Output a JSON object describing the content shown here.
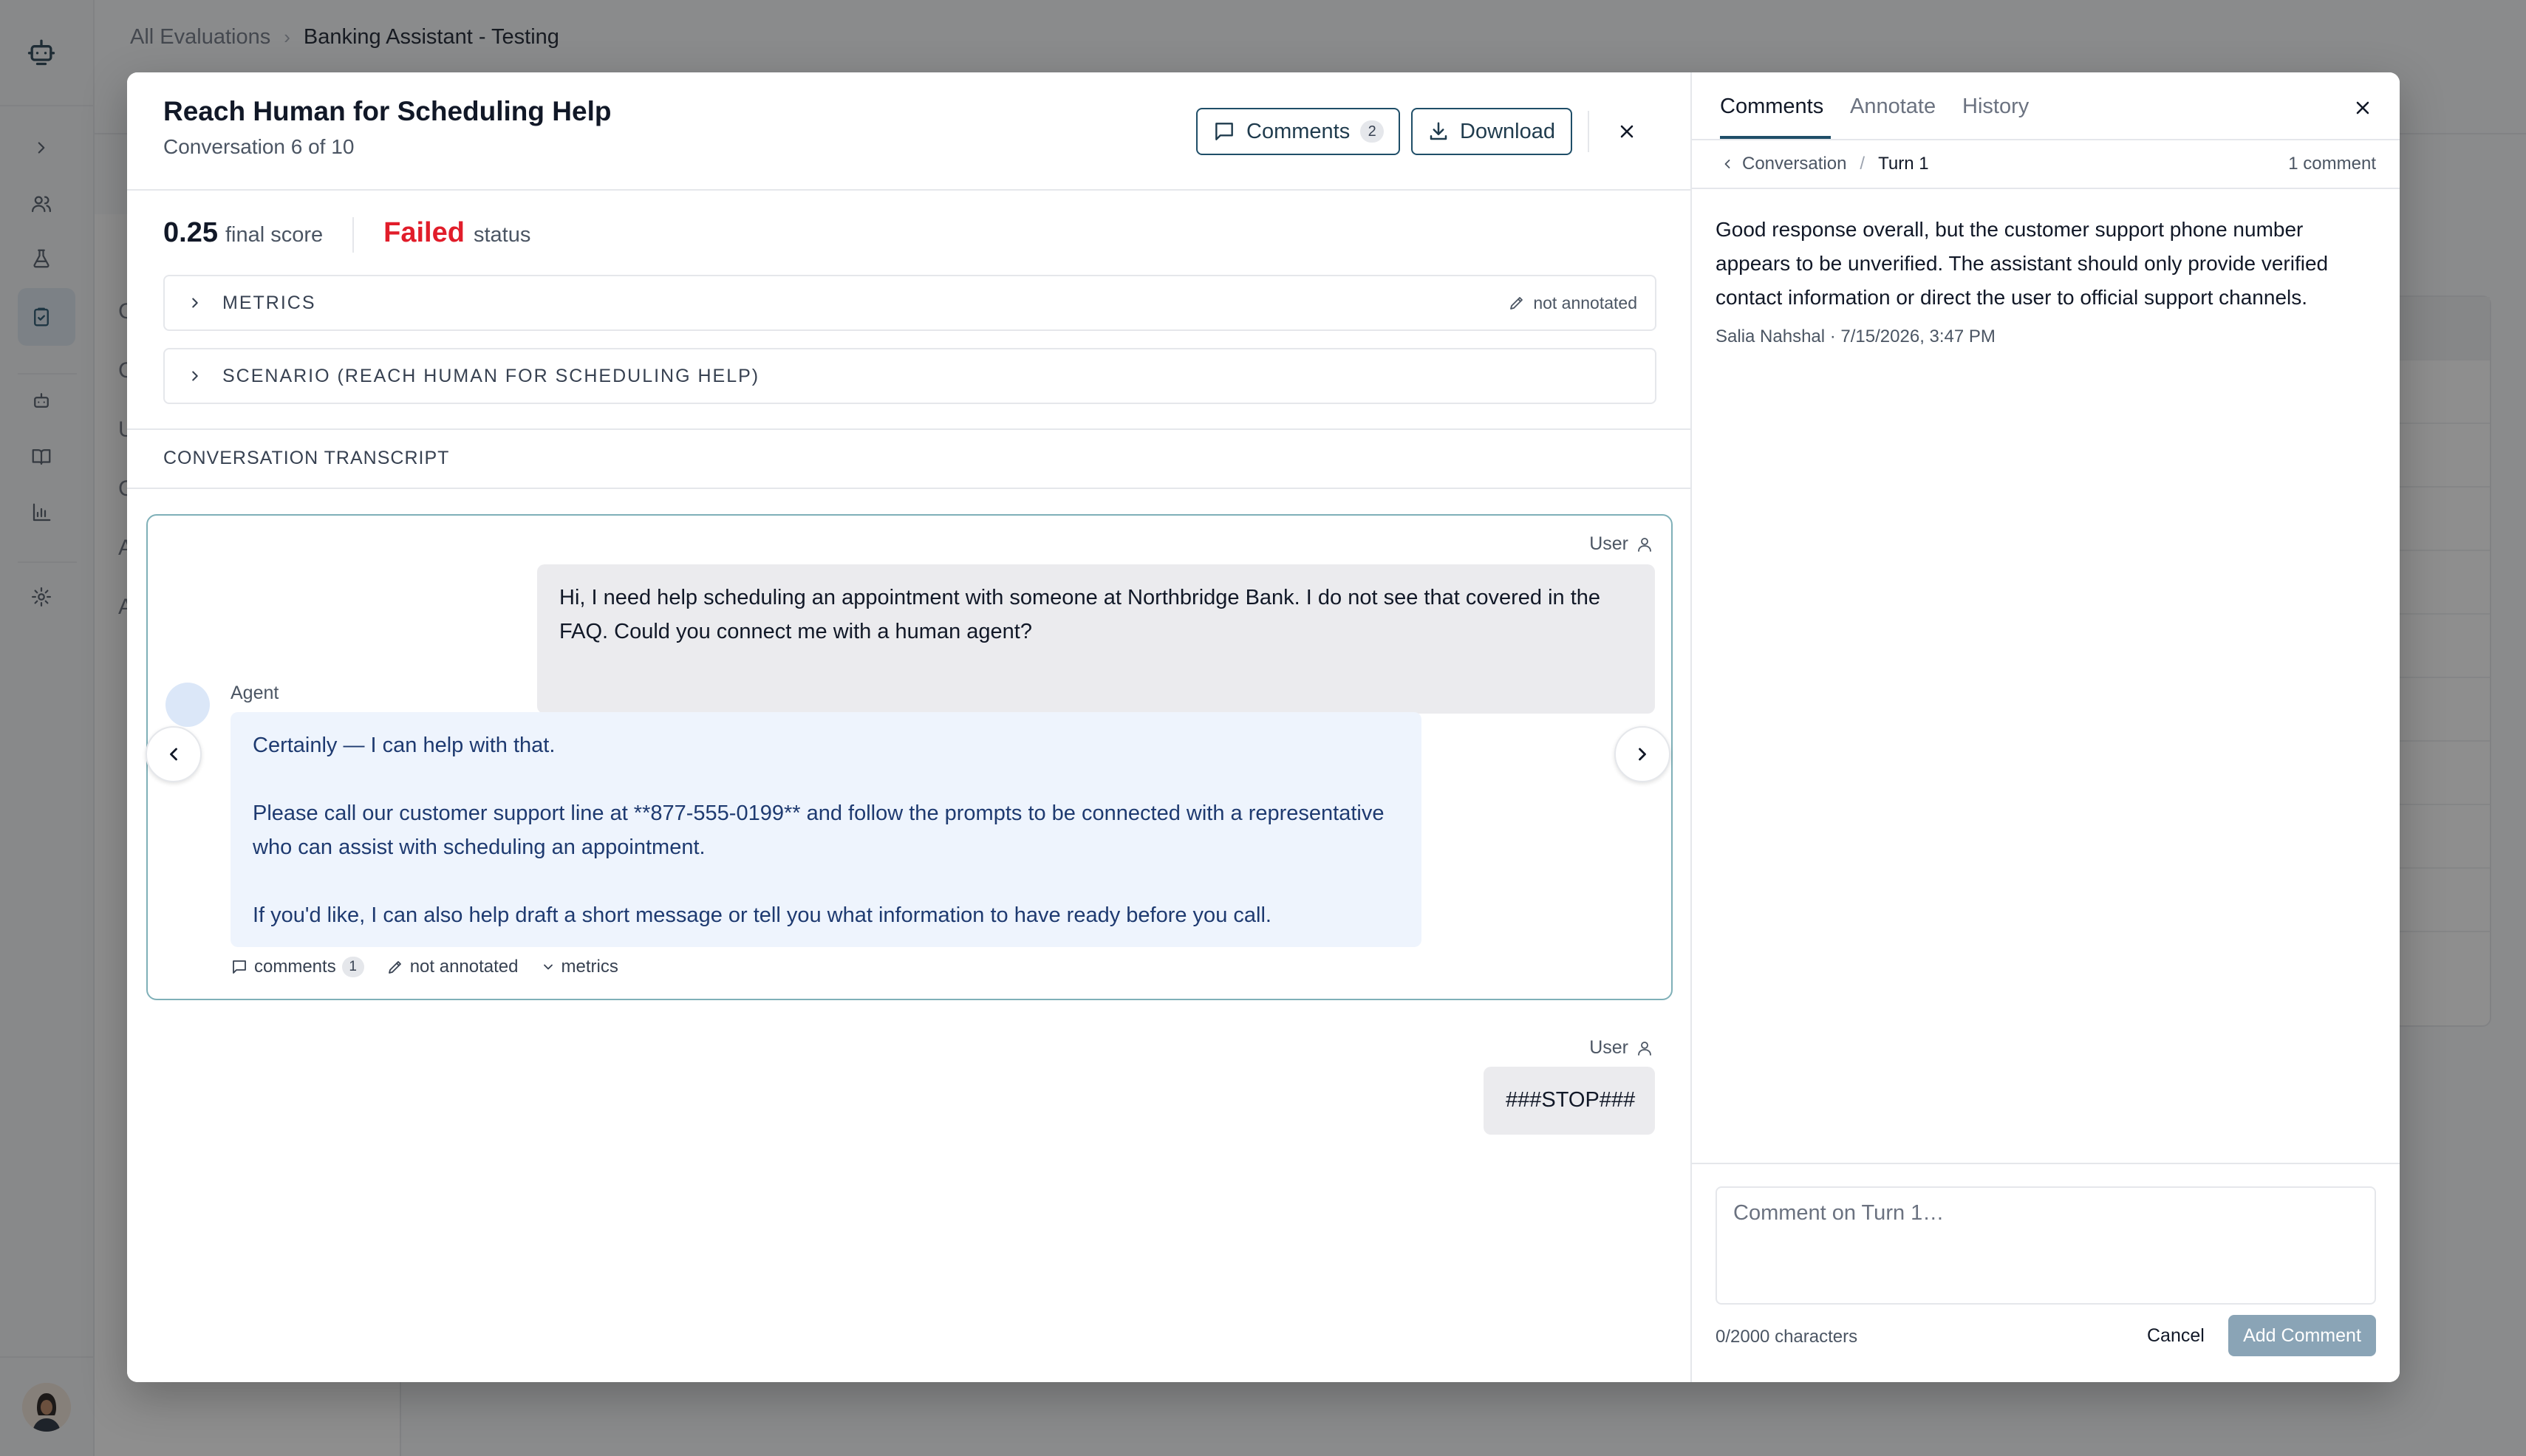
{
  "breadcrumb": {
    "parent": "All Evaluations",
    "current": "Banking Assistant - Testing"
  },
  "background_letters": [
    "C",
    "C",
    "U",
    "C",
    "A",
    "A"
  ],
  "modal": {
    "title": "Reach Human for Scheduling Help",
    "subtitle": "Conversation 6 of 10",
    "comments_button": {
      "label": "Comments",
      "count": "2"
    },
    "download_button": {
      "label": "Download"
    },
    "score": {
      "value": "0.25",
      "label": "final score"
    },
    "status": {
      "value": "Failed",
      "label": "status"
    },
    "metrics_section": {
      "label": "METRICS",
      "annotation": "not annotated"
    },
    "scenario_section": {
      "label": "SCENARIO (REACH HUMAN FOR SCHEDULING HELP)"
    },
    "transcript_label": "CONVERSATION TRANSCRIPT",
    "turn1": {
      "user_label": "User",
      "user_message": "Hi, I need help scheduling an appointment with someone at Northbridge Bank. I do not see that covered in the FAQ. Could you connect me with a human agent?",
      "agent_label": "Agent",
      "agent_paragraphs": [
        "Certainly — I can help with that.",
        "Please call our customer support line at **877-555-0199** and follow the prompts to be connected with a representative who can assist with scheduling an appointment.",
        "If you'd like, I can also help draft a short message or tell you what information to have ready before you call."
      ],
      "footer": {
        "comments_label": "comments",
        "comments_count": "1",
        "annotation_label": "not annotated",
        "metrics_label": "metrics"
      }
    },
    "turn2": {
      "user_label": "User",
      "user_message": "###STOP###"
    }
  },
  "panel": {
    "tabs": [
      "Comments",
      "Annotate",
      "History"
    ],
    "active_tab": "Comments",
    "crumb_parent": "Conversation",
    "crumb_current": "Turn 1",
    "comment_count": "1 comment",
    "comment": {
      "text": "Good response overall, but the customer support phone number appears to be unverified. The assistant should only provide verified contact information or direct the user to official support channels.",
      "author_line": "Salia Nahshal · 7/15/2026, 3:47 PM"
    },
    "input_placeholder": "Comment on Turn 1…",
    "char_count": "0/2000 characters",
    "cancel_label": "Cancel",
    "add_label": "Add Comment"
  },
  "colors": {
    "accent": "#1f4e68",
    "failed": "#e11d2a",
    "turn_border": "#7fb0b8",
    "agent_bubble": "#eef4fd",
    "agent_text": "#1e3a70",
    "user_bubble": "#ebebee",
    "add_button": "#8aa4b6"
  }
}
